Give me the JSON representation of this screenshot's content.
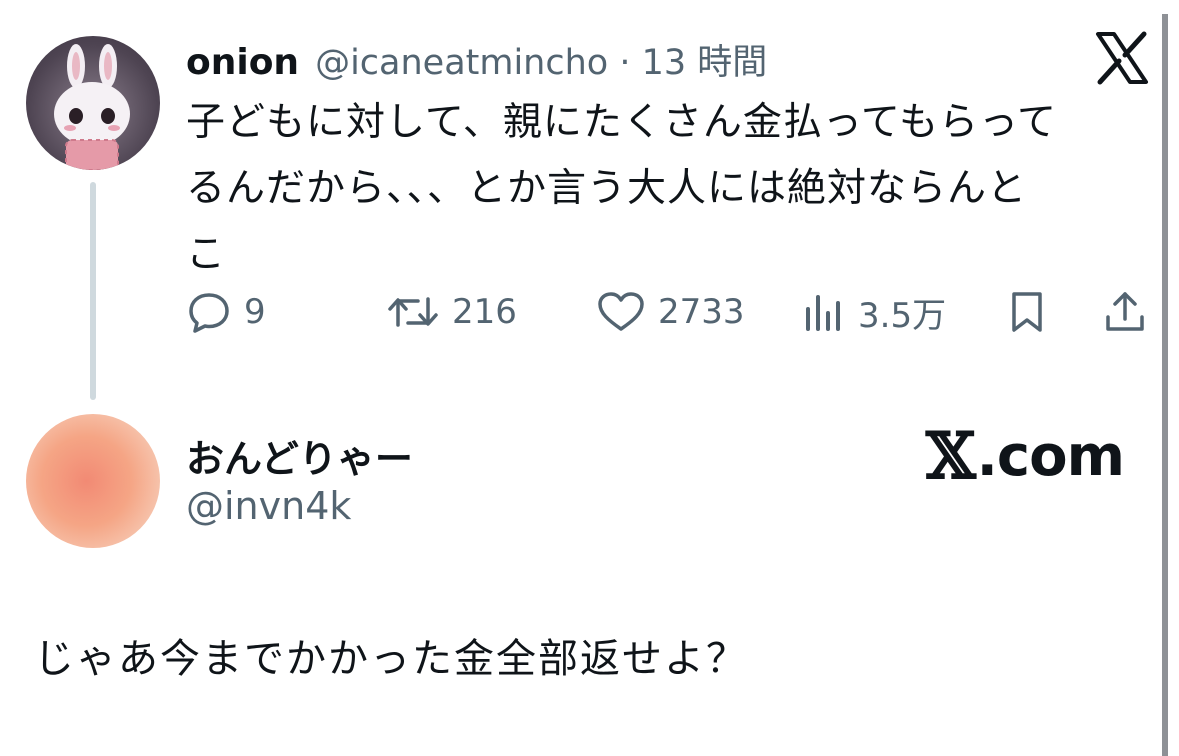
{
  "tweet": {
    "author_name": "onion",
    "author_meta": "@icaneatmincho · 13 時間",
    "body_lines": [
      "子どもに対して、親にたくさん金払ってもらって",
      "るんだから、、、とか言う大人には絶対ならんと",
      "こ"
    ],
    "actions": {
      "reply_icon": "speech-bubble-icon",
      "reply_count": "9",
      "repost_icon": "repost-arrows-icon",
      "repost_count": "216",
      "like_icon": "heart-icon",
      "like_count": "2733",
      "views_icon": "bar-chart-icon",
      "views_count": "3.5万",
      "bookmark_icon": "bookmark-icon",
      "share_icon": "share-icon"
    },
    "corner_icon": "x-logo-icon"
  },
  "reply": {
    "author_name": "おんどりゃー",
    "author_handle": "@invn4k",
    "brand_x": "𝕏",
    "brand_domain": ".com",
    "text": "じゃあ今までかかった金全部返せよ？"
  },
  "colors": {
    "text_primary": "#0f1419",
    "text_secondary": "#536471",
    "thread_line": "#cfd9de",
    "background": "#ffffff"
  }
}
